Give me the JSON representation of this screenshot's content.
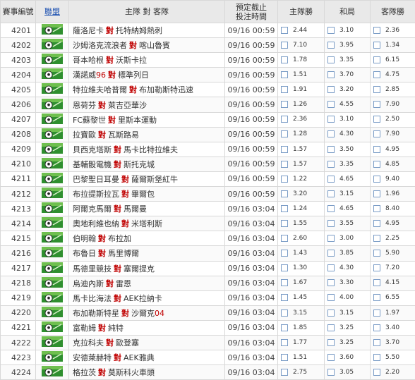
{
  "header": {
    "match_no": "賽事編號",
    "league": "聯盟",
    "teams": "主隊 對 客隊",
    "time": "預定截止\n投注時間",
    "home": "主隊勝",
    "draw": "和局",
    "away": "客隊勝"
  },
  "league_icon": "soccer-ball-icon",
  "rows": [
    {
      "no": "4201",
      "home": "薩洛尼卡",
      "vs": "對",
      "away": "托特納姆熱刺",
      "away_num": "",
      "time": "09/16 00:59",
      "h": "2.44",
      "d": "3.10",
      "a": "2.36"
    },
    {
      "no": "4202",
      "home": "沙姆洛克流浪者",
      "vs": "對",
      "away": "喀山魯賓",
      "away_num": "",
      "time": "09/16 00:59",
      "h": "7.10",
      "d": "3.95",
      "a": "1.34"
    },
    {
      "no": "4203",
      "home": "哥本哈根",
      "vs": "對",
      "away": "沃斯卡拉",
      "away_num": "",
      "time": "09/16 00:59",
      "h": "1.78",
      "d": "3.35",
      "a": "6.15"
    },
    {
      "no": "4204",
      "home": "漢諾威",
      "home_num": "96",
      "vs": "對",
      "away": "標準列日",
      "away_num": "",
      "time": "09/16 00:59",
      "h": "1.51",
      "d": "3.70",
      "a": "4.75"
    },
    {
      "no": "4205",
      "home": "特拉維夫哈普爾",
      "vs": "對",
      "away": "布加勒斯特迅速",
      "away_num": "",
      "time": "09/16 00:59",
      "h": "1.91",
      "d": "3.20",
      "a": "2.85"
    },
    {
      "no": "4206",
      "home": "恩荷芬",
      "vs": "對",
      "away": "萊吉亞華沙",
      "away_num": "",
      "time": "09/16 00:59",
      "h": "1.26",
      "d": "4.55",
      "a": "7.90"
    },
    {
      "no": "4207",
      "home": "FC蘇黎世",
      "vs": "對",
      "away": "里斯本運動",
      "away_num": "",
      "time": "09/16 00:59",
      "h": "2.36",
      "d": "3.10",
      "a": "2.50"
    },
    {
      "no": "4208",
      "home": "拉寶歐",
      "vs": "對",
      "away": "瓦斯路易",
      "away_num": "",
      "time": "09/16 00:59",
      "h": "1.28",
      "d": "4.30",
      "a": "7.90"
    },
    {
      "no": "4209",
      "home": "貝西克塔斯",
      "vs": "對",
      "away": "馬卡比特拉維夫",
      "away_num": "",
      "time": "09/16 00:59",
      "h": "1.57",
      "d": "3.50",
      "a": "4.95"
    },
    {
      "no": "4210",
      "home": "基輔骰電機",
      "vs": "對",
      "away": "斯托克城",
      "away_num": "",
      "time": "09/16 00:59",
      "h": "1.57",
      "d": "3.35",
      "a": "4.85"
    },
    {
      "no": "4211",
      "home": "巴黎聖日耳曼",
      "vs": "對",
      "away": "薩爾斯堡紅牛",
      "away_num": "",
      "time": "09/16 00:59",
      "h": "1.22",
      "d": "4.65",
      "a": "9.40"
    },
    {
      "no": "4212",
      "home": "布拉提斯拉瓦",
      "vs": "對",
      "away": "畢爾包",
      "away_num": "",
      "time": "09/16 00:59",
      "h": "3.20",
      "d": "3.15",
      "a": "1.96"
    },
    {
      "no": "4213",
      "home": "阿爾克馬爾",
      "vs": "對",
      "away": "馬爾曼",
      "away_num": "",
      "time": "09/16 03:04",
      "h": "1.24",
      "d": "4.65",
      "a": "8.40"
    },
    {
      "no": "4214",
      "home": "奧地利維也納",
      "vs": "對",
      "away": "米塔利斯",
      "away_num": "",
      "time": "09/16 03:04",
      "h": "1.55",
      "d": "3.55",
      "a": "4.95"
    },
    {
      "no": "4215",
      "home": "伯明翰",
      "vs": "對",
      "away": "布拉加",
      "away_num": "",
      "time": "09/16 03:04",
      "h": "2.60",
      "d": "3.00",
      "a": "2.25"
    },
    {
      "no": "4216",
      "home": "布魯日",
      "vs": "對",
      "away": "馬里博爾",
      "away_num": "",
      "time": "09/16 03:04",
      "h": "1.43",
      "d": "3.85",
      "a": "5.90"
    },
    {
      "no": "4217",
      "home": "馬德里競技",
      "vs": "對",
      "away": "塞爾提克",
      "away_num": "",
      "time": "09/16 03:04",
      "h": "1.30",
      "d": "4.30",
      "a": "7.20"
    },
    {
      "no": "4218",
      "home": "烏迪內斯",
      "vs": "對",
      "away": "雷恩",
      "away_num": "",
      "time": "09/16 03:04",
      "h": "1.67",
      "d": "3.30",
      "a": "4.15"
    },
    {
      "no": "4219",
      "home": "馬卡比海法",
      "vs": "對",
      "away": "AEK拉納卡",
      "away_num": "",
      "time": "09/16 03:04",
      "h": "1.45",
      "d": "4.00",
      "a": "6.55"
    },
    {
      "no": "4220",
      "home": "布加勒斯特星",
      "vs": "對",
      "away": "沙爾克",
      "away_num": "04",
      "time": "09/16 03:04",
      "h": "3.15",
      "d": "3.15",
      "a": "1.97"
    },
    {
      "no": "4221",
      "home": "富勒姆",
      "vs": "對",
      "away": "純特",
      "away_num": "",
      "time": "09/16 03:04",
      "h": "1.85",
      "d": "3.25",
      "a": "3.40"
    },
    {
      "no": "4222",
      "home": "克拉科夫",
      "vs": "對",
      "away": "歐登塞",
      "away_num": "",
      "time": "09/16 03:04",
      "h": "1.77",
      "d": "3.25",
      "a": "3.70"
    },
    {
      "no": "4223",
      "home": "安德萊赫特",
      "vs": "對",
      "away": "AEK雅典",
      "away_num": "",
      "time": "09/16 03:04",
      "h": "1.51",
      "d": "3.60",
      "a": "5.50"
    },
    {
      "no": "4224",
      "home": "格拉茨",
      "vs": "對",
      "away": "莫斯科火車頭",
      "away_num": "",
      "time": "09/16 03:04",
      "h": "2.75",
      "d": "3.05",
      "a": "2.20"
    }
  ]
}
